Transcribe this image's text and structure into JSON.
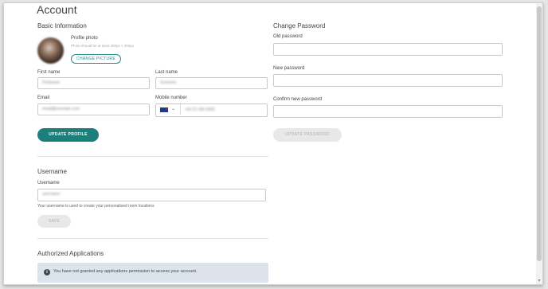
{
  "page": {
    "title": "Account"
  },
  "basic_info": {
    "heading": "Basic Information",
    "profile_photo_label": "Profile photo",
    "profile_photo_hint": "Photo should be at least 300px × 300px",
    "change_picture": "CHANGE PICTURE",
    "first_name_label": "First name",
    "first_name_value": "Firstname",
    "last_name_label": "Last name",
    "last_name_value": "Surname",
    "email_label": "Email",
    "email_value": "email@example.com",
    "mobile_label": "Mobile number",
    "mobile_value": "+64 21 000 0000",
    "update_profile": "UPDATE PROFILE"
  },
  "password": {
    "heading": "Change Password",
    "old_label": "Old password",
    "new_label": "New password",
    "confirm_label": "Confirm new password",
    "update_password": "UPDATE PASSWORD"
  },
  "username": {
    "heading": "Username",
    "label": "Username",
    "value": "username",
    "help": "Your username is used to create your personalised room locations",
    "save": "SAVE"
  },
  "apps": {
    "heading": "Authorized Applications",
    "info": "You have not granted any applications permission to access your account."
  },
  "colors": {
    "accent": "#1d7f7b",
    "info_bg": "#dde3ea"
  },
  "icons": {
    "info": "info-icon",
    "dropdown": "chevron-down-icon",
    "flag": "nz-flag-icon"
  }
}
